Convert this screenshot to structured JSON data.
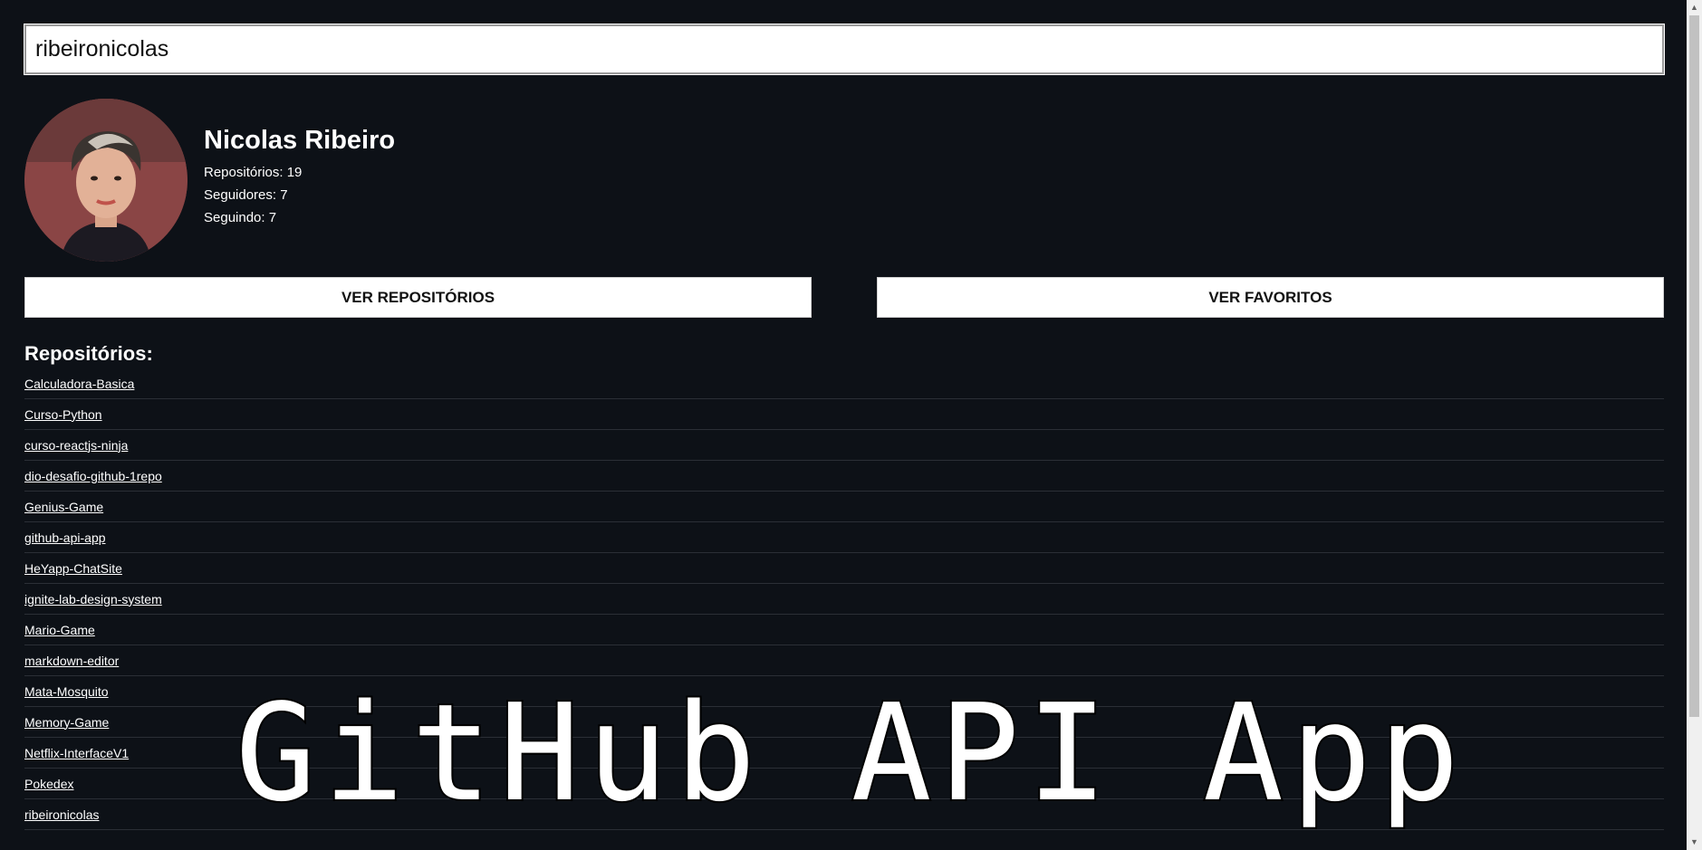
{
  "search": {
    "value": "ribeironicolas"
  },
  "profile": {
    "name": "Nicolas Ribeiro",
    "repos_label": "Repositórios: 19",
    "followers_label": "Seguidores: 7",
    "following_label": "Seguindo: 7"
  },
  "buttons": {
    "repos_label": "VER REPOSITÓRIOS",
    "favorites_label": "VER FAVORITOS"
  },
  "repositories": {
    "heading": "Repositórios:",
    "items": [
      "Calculadora-Basica",
      "Curso-Python",
      "curso-reactjs-ninja",
      "dio-desafio-github-1repo",
      "Genius-Game",
      "github-api-app",
      "HeYapp-ChatSite",
      "ignite-lab-design-system",
      "Mario-Game",
      "markdown-editor",
      "Mata-Mosquito",
      "Memory-Game",
      "Netflix-InterfaceV1",
      "Pokedex",
      "ribeironicolas"
    ]
  },
  "overlay": {
    "title": "GitHub API App"
  },
  "colors": {
    "background": "#0d1117",
    "text": "#ffffff",
    "button_bg": "#ffffff"
  },
  "icons": {
    "scroll_up": "scroll-up-arrow-icon",
    "scroll_down": "scroll-down-arrow-icon"
  }
}
